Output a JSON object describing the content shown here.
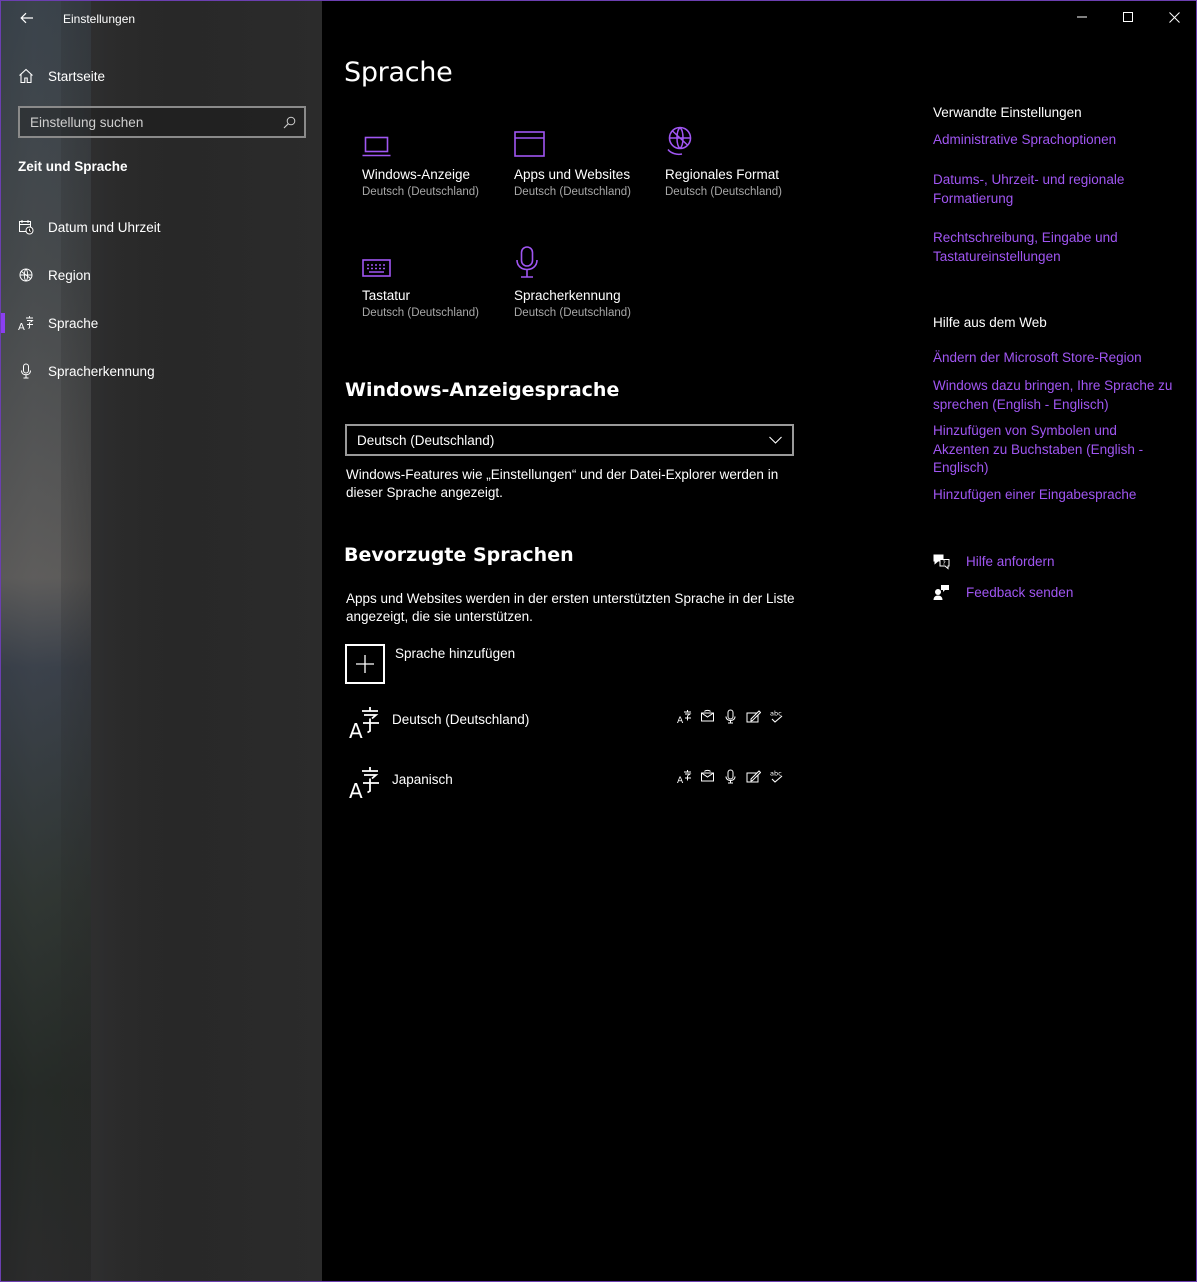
{
  "window": {
    "title": "Einstellungen",
    "accent": "#a056f2"
  },
  "sidebar": {
    "home_label": "Startseite",
    "search_placeholder": "Einstellung suchen",
    "section_title": "Zeit und Sprache",
    "items": [
      {
        "label": "Datum und Uhrzeit",
        "icon": "calendar-clock-icon"
      },
      {
        "label": "Region",
        "icon": "globe-icon"
      },
      {
        "label": "Sprache",
        "icon": "language-icon",
        "active": true
      },
      {
        "label": "Spracherkennung",
        "icon": "microphone-icon"
      }
    ]
  },
  "main": {
    "title": "Sprache",
    "tiles": [
      {
        "label": "Windows-Anzeige",
        "sub": "Deutsch (Deutschland)",
        "icon": "laptop-icon"
      },
      {
        "label": "Apps und Websites",
        "sub": "Deutsch (Deutschland)",
        "icon": "browser-window-icon"
      },
      {
        "label": "Regionales Format",
        "sub": "Deutsch (Deutschland)",
        "icon": "globe-format-icon"
      },
      {
        "label": "Tastatur",
        "sub": "Deutsch (Deutschland)",
        "icon": "keyboard-icon"
      },
      {
        "label": "Spracherkennung",
        "sub": "Deutsch (Deutschland)",
        "icon": "microphone-icon"
      }
    ],
    "display_language": {
      "heading": "Windows-Anzeigesprache",
      "selected": "Deutsch (Deutschland)",
      "description": "Windows-Features wie „Einstellungen“ und der Datei-Explorer werden in dieser Sprache angezeigt."
    },
    "preferred": {
      "heading": "Bevorzugte Sprachen",
      "description": "Apps und Websites werden in der ersten unterstützten Sprache in der Liste angezeigt, die sie unterstützen.",
      "add_label": "Sprache hinzufügen",
      "languages": [
        {
          "name": "Deutsch (Deutschland)"
        },
        {
          "name": "Japanisch"
        }
      ]
    }
  },
  "right": {
    "related_heading": "Verwandte Einstellungen",
    "related_links": [
      "Administrative Sprachoptionen",
      "Datums-, Uhrzeit- und regionale Formatierung",
      "Rechtschreibung, Eingabe und Tastatureinstellungen"
    ],
    "web_heading": "Hilfe aus dem Web",
    "web_links": [
      "Ändern der Microsoft Store-Region",
      "Windows dazu bringen, Ihre Sprache zu sprechen (English - Englisch)",
      "Hinzufügen von Symbolen und Akzenten zu Buchstaben (English - Englisch)",
      "Hinzufügen einer Eingabesprache"
    ],
    "help_label": "Hilfe anfordern",
    "feedback_label": "Feedback senden"
  }
}
